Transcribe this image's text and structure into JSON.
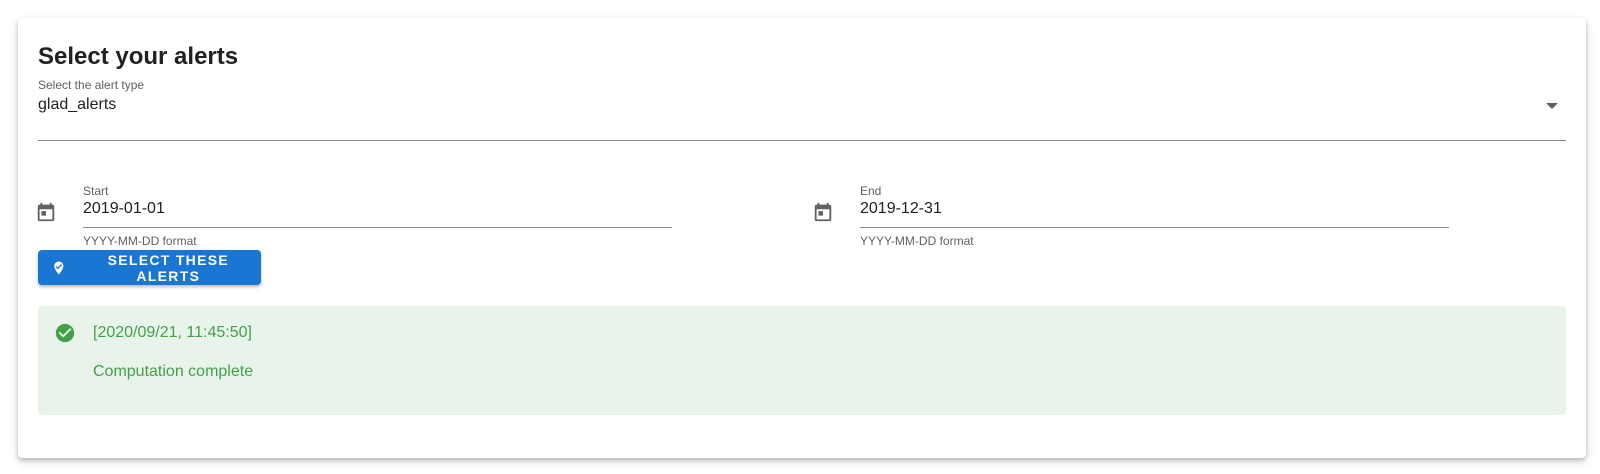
{
  "panel": {
    "title": "Select your alerts"
  },
  "alert_type": {
    "label": "Select the alert type",
    "value": "glad_alerts"
  },
  "date_range": {
    "start": {
      "label": "Start",
      "value": "2019-01-01",
      "helper": "YYYY-MM-DD format"
    },
    "end": {
      "label": "End",
      "value": "2019-12-31",
      "helper": "YYYY-MM-DD format"
    }
  },
  "action": {
    "label": "Select these alerts",
    "icon": "map-marker-check-icon"
  },
  "status": {
    "icon": "check-circle-icon",
    "timestamp": "[2020/09/21, 11:45:50]",
    "message": "Computation complete"
  },
  "colors": {
    "primary": "#1976d2",
    "success_text": "#43a047",
    "success_background": "#e8f4ea",
    "icon_gray": "#616161"
  }
}
